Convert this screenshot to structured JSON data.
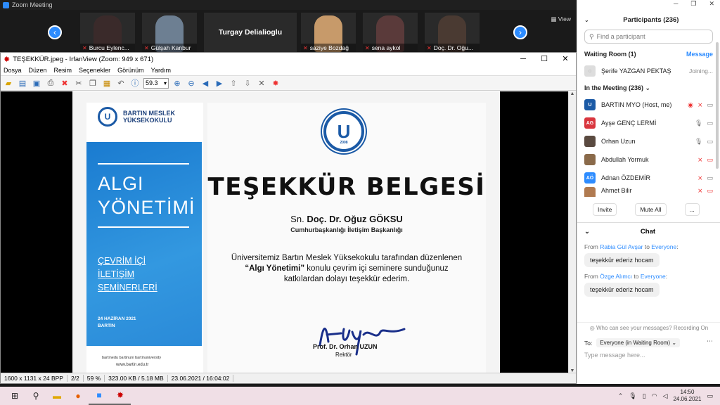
{
  "zoom": {
    "window_title": "Zoom Meeting",
    "view_label": "View",
    "gallery": [
      {
        "name": "Burcu Eylenc...",
        "face": "#3a2a2a"
      },
      {
        "name": "Gülşah Kanbur",
        "face": "#6d7f92"
      },
      {
        "name": "Turgay Delialioglu",
        "face": ""
      },
      {
        "name": "saziye Bozdağ",
        "face": "#c79a6a"
      },
      {
        "name": "sena aykol",
        "face": "#5a3a3a"
      },
      {
        "name": "Doç. Dr. Oğu...",
        "face": "#4a3a32"
      }
    ]
  },
  "irfanview": {
    "title": "TEŞEKKÜR.jpeg - IrfanView (Zoom: 949 x 671)",
    "menu": [
      "Dosya",
      "Düzen",
      "Resim",
      "Seçenekler",
      "Görünüm",
      "Yardım"
    ],
    "zoom_value": "59.3",
    "status": [
      "1600 x 1131 x 24 BPP",
      "2/2",
      "59 %",
      "323.00 KB / 5.18 MB",
      "23.06.2021 / 16:04:02"
    ]
  },
  "certificate": {
    "school_line1": "BARTIN MESLEK",
    "school_line2": "YÜKSEKOKULU",
    "topic_line1": "ALGI",
    "topic_line2": "YÖNETİMİ",
    "series_line1": "ÇEVRİM İÇİ",
    "series_line2": "İLETİŞİM",
    "series_line3": "SEMİNERLERİ",
    "date": "24 HAZİRAN 2021",
    "city": "BARTIN",
    "social": "bartinedu  bartinuni  bartinuniversity",
    "website": "www.bartin.edu.tr",
    "seal_year": "2008",
    "title": "TEŞEKKÜR BELGESİ",
    "honorific": "Sn.",
    "recipient": "Doç. Dr. Oğuz GÖKSU",
    "recipient_org": "Cumhurbaşkanlığı İletişim Başkanlığı",
    "body_line1": "Üniversitemiz Bartın Meslek Yüksekokulu tarafından düzenlenen",
    "body_quote": "“Algı Yönetimi”",
    "body_line2_rest": " konulu çevrim içi seminere sunduğunuz",
    "body_line3": "katkılardan dolayı teşekkür ederim.",
    "signer": "Prof. Dr. Orhan UZUN",
    "signer_title": "Rektör"
  },
  "participants": {
    "header": "Participants (236)",
    "search_placeholder": "Find a participant",
    "waiting_room": "Waiting Room (1)",
    "message_label": "Message",
    "waiting": [
      {
        "name": "Şerife YAZGAN PEKTAŞ",
        "status": "Joining..."
      }
    ],
    "in_meeting": "In the Meeting (236)",
    "list": [
      {
        "name": "BARTIN MYO (Host, me)",
        "initials": "",
        "color": "#1b5aa6"
      },
      {
        "name": "Ayşe GENÇ LERMİ",
        "initials": "AG",
        "color": "#d9363e"
      },
      {
        "name": "Orhan Uzun",
        "initials": "",
        "color": "#5a4a40"
      },
      {
        "name": "Abdullah Yormuk",
        "initials": "",
        "color": "#8a6a4a"
      },
      {
        "name": "Adnan ÖZDEMİR",
        "initials": "AÖ",
        "color": "#2d8cff"
      },
      {
        "name": "Ahmet Bilir",
        "initials": "",
        "color": "#b07a50"
      }
    ],
    "invite": "Invite",
    "mute_all": "Mute All",
    "more": "..."
  },
  "chat": {
    "header": "Chat",
    "messages": [
      {
        "from_prefix": "From ",
        "from": "Rabia Gül Avşar",
        "to_prefix": " to ",
        "to": "Everyone",
        "colon": ":",
        "text": "teşekkür ederiz hocam"
      },
      {
        "from_prefix": "From ",
        "from": "Özge Alımcı",
        "to_prefix": " to ",
        "to": "Everyone",
        "colon": ":",
        "text": "teşekkür ederiz hocam"
      }
    ],
    "notice": "Who can see your messages? Recording On",
    "to_label": "To:",
    "to_value": "Everyone (in Waiting Room)",
    "input_placeholder": "Type message here..."
  },
  "taskbar": {
    "time": "14:50",
    "date": "24.06.2021"
  }
}
